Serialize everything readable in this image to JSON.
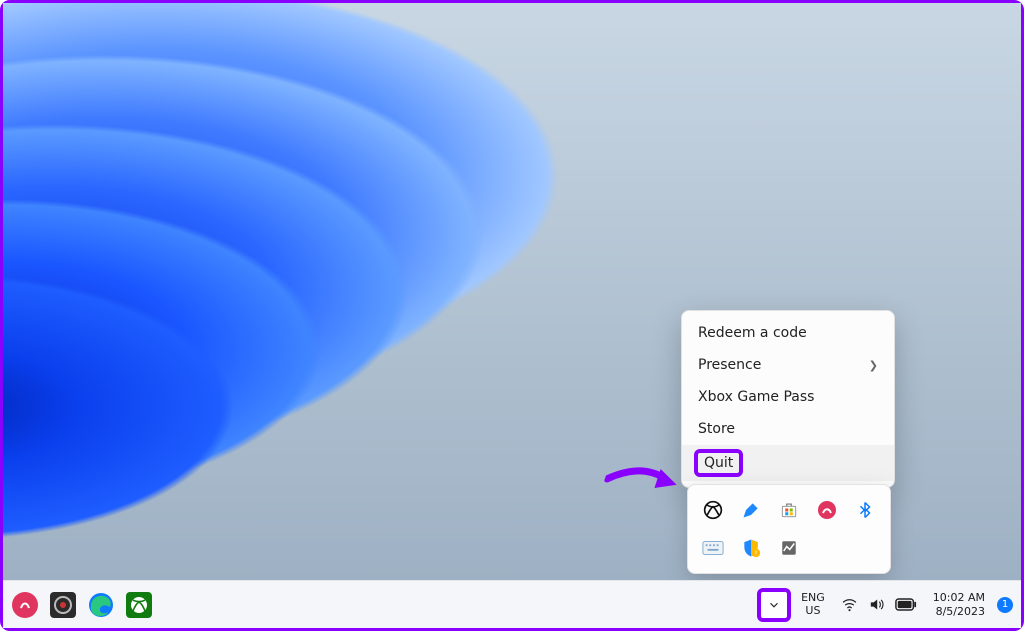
{
  "context_menu": {
    "items": [
      {
        "label": "Redeem a code",
        "has_submenu": false
      },
      {
        "label": "Presence",
        "has_submenu": true
      },
      {
        "label": "Xbox Game Pass",
        "has_submenu": false
      },
      {
        "label": "Store",
        "has_submenu": false
      },
      {
        "label": "Quit",
        "has_submenu": false
      }
    ],
    "hovered_index": 4,
    "highlighted_index": 4
  },
  "tray_flyout": {
    "icons": [
      "xbox-icon",
      "pen-icon",
      "microsoft-store-icon",
      "snagit-icon",
      "bluetooth-icon",
      "touch-keyboard-icon",
      "windows-security-icon",
      "task-manager-icon"
    ]
  },
  "taskbar": {
    "pinned": [
      "snagit-icon",
      "obs-icon",
      "edge-icon",
      "xbox-icon"
    ],
    "language_line1": "ENG",
    "language_line2": "US",
    "time": "10:02 AM",
    "date": "8/5/2023",
    "notification_count": "1"
  },
  "annotations": {
    "tray_chevron_highlighted": true,
    "quit_highlighted": true,
    "arrow_pointing_to": "xbox-icon"
  }
}
